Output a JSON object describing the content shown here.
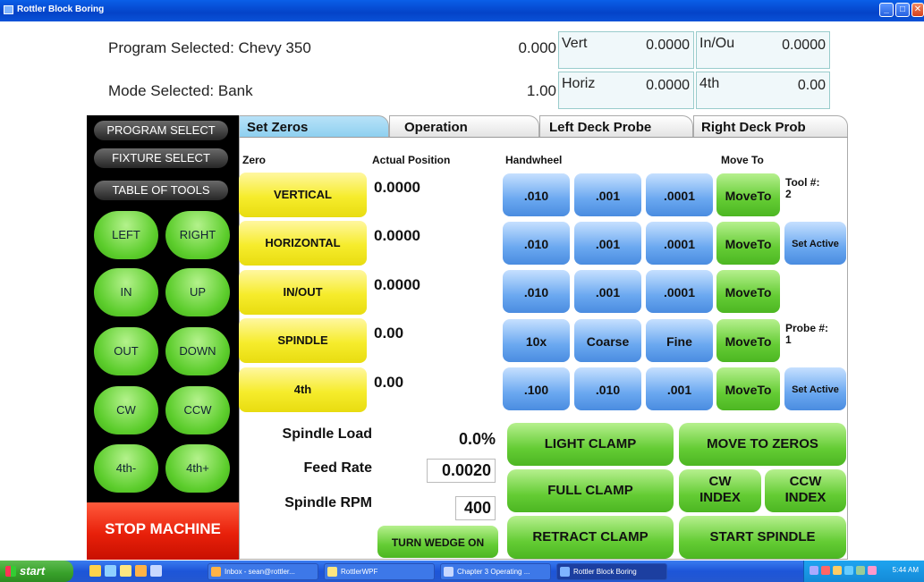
{
  "window": {
    "title": "Rottler Block Boring"
  },
  "header": {
    "program_label": "Program Selected: Chevy 350",
    "mode_label": "Mode Selected: Bank",
    "num1": "0.000",
    "num2": "1.00",
    "vert_label": "Vert",
    "vert_value": "0.0000",
    "horiz_label": "Horiz",
    "horiz_value": "0.0000",
    "inout_label": "In/Ou",
    "inout_value": "0.0000",
    "fourth_label": "4th",
    "fourth_value": "0.00"
  },
  "leftpanel": {
    "program_select": "PROGRAM SELECT",
    "fixture_select": "FIXTURE SELECT",
    "table_of_tools": "TABLE OF TOOLS",
    "jog": [
      "LEFT",
      "RIGHT",
      "IN",
      "UP",
      "OUT",
      "DOWN",
      "CW",
      "CCW",
      "4th-",
      "4th+"
    ],
    "stop": "STOP MACHINE"
  },
  "tabs": [
    "Set Zeros",
    "Operation",
    "Left Deck Probe",
    "Right Deck Prob"
  ],
  "columns": {
    "zero": "Zero",
    "actual": "Actual Position",
    "handwheel": "Handwheel",
    "moveto": "Move To"
  },
  "zeros": [
    "VERTICAL",
    "HORIZONTAL",
    "IN/OUT",
    "SPINDLE",
    "4th"
  ],
  "positions": [
    "0.0000",
    "0.0000",
    "0.0000",
    "0.00",
    "0.00"
  ],
  "handwheel": [
    [
      ".010",
      ".001",
      ".0001"
    ],
    [
      ".010",
      ".001",
      ".0001"
    ],
    [
      ".010",
      ".001",
      ".0001"
    ],
    [
      "10x",
      "Coarse",
      "Fine"
    ],
    [
      ".100",
      ".010",
      ".001"
    ]
  ],
  "moveto_label": "MoveTo",
  "set_active": "Set Active",
  "tool_label": "Tool #:",
  "tool_value": "2",
  "probe_label": "Probe #:",
  "probe_value": "1",
  "stats": {
    "spindle_load_label": "Spindle Load",
    "spindle_load_value": "0.0%",
    "feed_rate_label": "Feed Rate",
    "feed_rate_value": "0.0020",
    "spindle_rpm_label": "Spindle RPM",
    "spindle_rpm_value": "400"
  },
  "turn_wedge": "TURN WEDGE ON",
  "clamps": {
    "light": "LIGHT CLAMP",
    "full": "FULL CLAMP",
    "retract": "RETRACT CLAMP",
    "move_zeros": "MOVE TO ZEROS",
    "cw_index_1": "CW",
    "cw_index_2": "INDEX",
    "ccw_index_1": "CCW",
    "ccw_index_2": "INDEX",
    "start_spindle": "START SPINDLE"
  },
  "taskbar": {
    "start": "start",
    "tasks": [
      "Inbox - sean@rottler...",
      "RottlerWPF",
      "Chapter 3 Operating ...",
      "Rottler Block Boring"
    ],
    "clock": "5:44 AM"
  },
  "colors": {
    "yellow": "#f6ec2c",
    "blue": "#6aa8f0",
    "green": "#64cc34",
    "red": "#e8200a",
    "tab_active": "#8ccfef"
  }
}
